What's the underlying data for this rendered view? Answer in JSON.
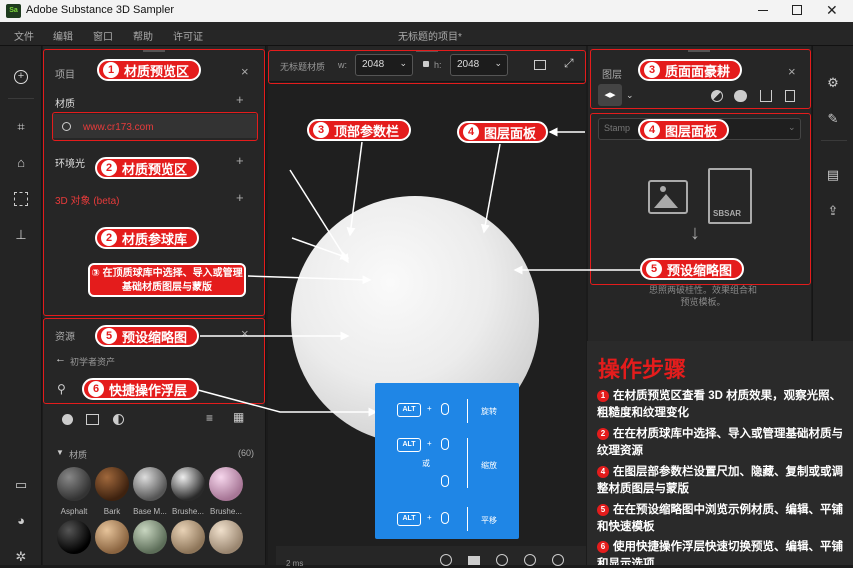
{
  "window": {
    "title": "Adobe Substance 3D Sampler",
    "doc_title": "无标题的项目*"
  },
  "menu": [
    "文件",
    "编辑",
    "窗口",
    "帮助",
    "许可证"
  ],
  "left_panel": {
    "header": "项目",
    "materials_label": "材质",
    "search_value": "www.cr173.com",
    "environment_label": "环境光",
    "objects_label": "3D 对象 (beta)",
    "assets_header": "资源",
    "back_label": "初学者资产",
    "category_label": "材质",
    "category_count": "(60)",
    "thumbs_row1": [
      "Asphalt",
      "Bark",
      "Base M...",
      "Brushe...",
      "Brushe..."
    ]
  },
  "top_params": {
    "label": "无标题材质",
    "w_label": "w:",
    "w_value": "2048",
    "h_label": "h:",
    "h_value": "2048"
  },
  "right_panel": {
    "header": "图层",
    "dropdown_text": "Stamp",
    "desc": "思照两破桂性。效果组合和预览模板。",
    "placeholder_text": "SBSAR"
  },
  "bottom_bar": {
    "time": "2 ms"
  },
  "callouts": {
    "c1_num": "1",
    "c1": "材质预览区",
    "c2a_num": "2",
    "c2a": "材质预览区",
    "c2b_num": "2",
    "c2b": "材质参球库",
    "c3_text": "③ 在顶质球库中选择、导入或管理基础材质图层与蒙版",
    "c5a_num": "5",
    "c5a": "预设缩略图",
    "c6_num": "6",
    "c6": "快捷操作浮层",
    "c3a_num": "3",
    "c3a": "质面面豪耕",
    "c3b_num": "3",
    "c3b": "顶部参数栏",
    "c4a_num": "4",
    "c4a": "图层面板",
    "c4b_num": "4",
    "c4b": "图层面板",
    "c5b_num": "5",
    "c5b": "预设缩略图"
  },
  "shortcut": {
    "alt": "ALT",
    "rotate": "旋转",
    "or": "或",
    "zoom": "缩放",
    "pan": "平移"
  },
  "steps": {
    "title": "操作步骤",
    "items": [
      {
        "num": "1",
        "text": "在材质预览区查看 3D 材质效果，观察光照、粗糙度和纹理变化"
      },
      {
        "num": "2",
        "text": "在在材质球库中选择、导入或管理基础材质与纹理资源"
      },
      {
        "num": "4",
        "text": "在图层部参数栏设置尺加、隐藏、复制或或调整材质图层与蒙版"
      },
      {
        "num": "5",
        "text": "在在预设缩略图中浏览示例材质、编辑、平铺和快速模板"
      },
      {
        "num": "6",
        "text": "使用快捷操作浮层快速切换预览、编辑、平铺和显示选项"
      }
    ]
  },
  "colors": {
    "accent": "#e41c1c",
    "shortcut_bg": "#1f86e6"
  }
}
